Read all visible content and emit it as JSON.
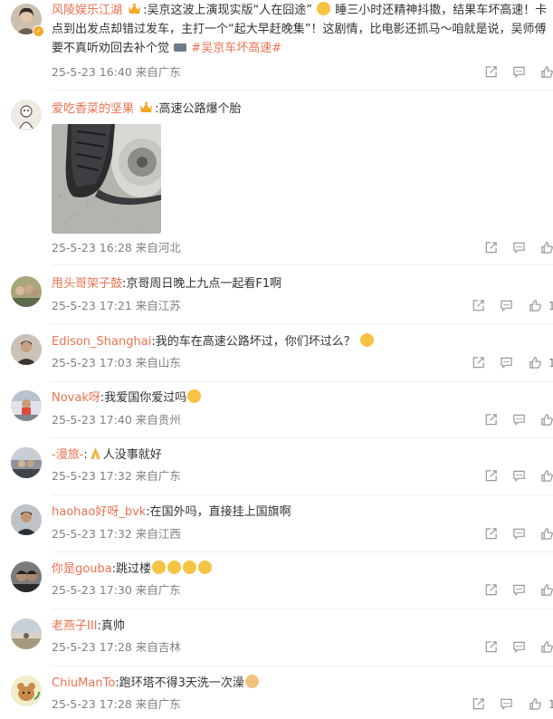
{
  "comments": [
    {
      "username": "风陵娱乐江湖",
      "text_a": ":吴京这波上演现实版“人在囧途”",
      "text_b": " 睡三小时还精神抖擞，结果车坏高速！卡点到出发点却错过发车，主打一个“起大早赶晚集”！这剧情，比电影还抓马～咱就是说，吴师傅要不真听劝回去补个觉",
      "hashtag": "#吴京车坏高速#",
      "date": "25-5-23 16:40",
      "location": "来自广东",
      "avatar_color": "#7a6a58"
    },
    {
      "username": "爱吃香菜的坚果",
      "text": ":高速公路爆个胎",
      "date": "25-5-23 16:28",
      "location": "来自河北",
      "image_alt": "flat-tire-photo",
      "avatar_color": "#e8e2dc"
    },
    {
      "username": "甩头哥架子鼓",
      "text": ":京哥周日晚上九点一起看F1啊",
      "date": "25-5-23 17:21",
      "location": "来自江苏",
      "like_count": "1",
      "avatar_color": "#8d8a6a"
    },
    {
      "username": "Edison_Shanghai",
      "text": ":我的车在高速公路坏过，你们坏过么？",
      "date": "25-5-23 17:03",
      "location": "来自山东",
      "like_count": "1",
      "avatar_color": "#5a5048"
    },
    {
      "username": "Novak呀",
      "text": ":我爱国你爱过吗",
      "date": "25-5-23 17:40",
      "location": "来自贵州",
      "avatar_color": "#9aa0a8"
    },
    {
      "username": "-漫旅-",
      "text": ":",
      "text_after": "人没事就好",
      "date": "25-5-23 17:32",
      "location": "来自广东",
      "avatar_color": "#6a6e74"
    },
    {
      "username": "haohao好呀_bvk",
      "text": ":在国外吗，直接挂上国旗啊",
      "date": "25-5-23 17:32",
      "location": "来自江西",
      "avatar_color": "#5b5e63"
    },
    {
      "username": "你是gouba",
      "text": ":跳过楼",
      "date": "25-5-23 17:30",
      "location": "来自广东",
      "avatar_color": "#4a4a4a"
    },
    {
      "username": "老燕子III",
      "text": ":真帅",
      "date": "25-5-23 17:28",
      "location": "来自吉林",
      "avatar_color": "#b7b3a6"
    },
    {
      "username": "ChiuManTo",
      "text": ":跑环塔不得3天洗一次澡",
      "date": "25-5-23 17:28",
      "location": "来自广东",
      "like_count": "1",
      "avatar_color": "#e7dfa8"
    }
  ],
  "colors": {
    "username": "#eb7350",
    "meta": "#808080",
    "icon": "#9a9a9a"
  },
  "icons": [
    "share-icon",
    "comment-icon",
    "like-icon"
  ]
}
